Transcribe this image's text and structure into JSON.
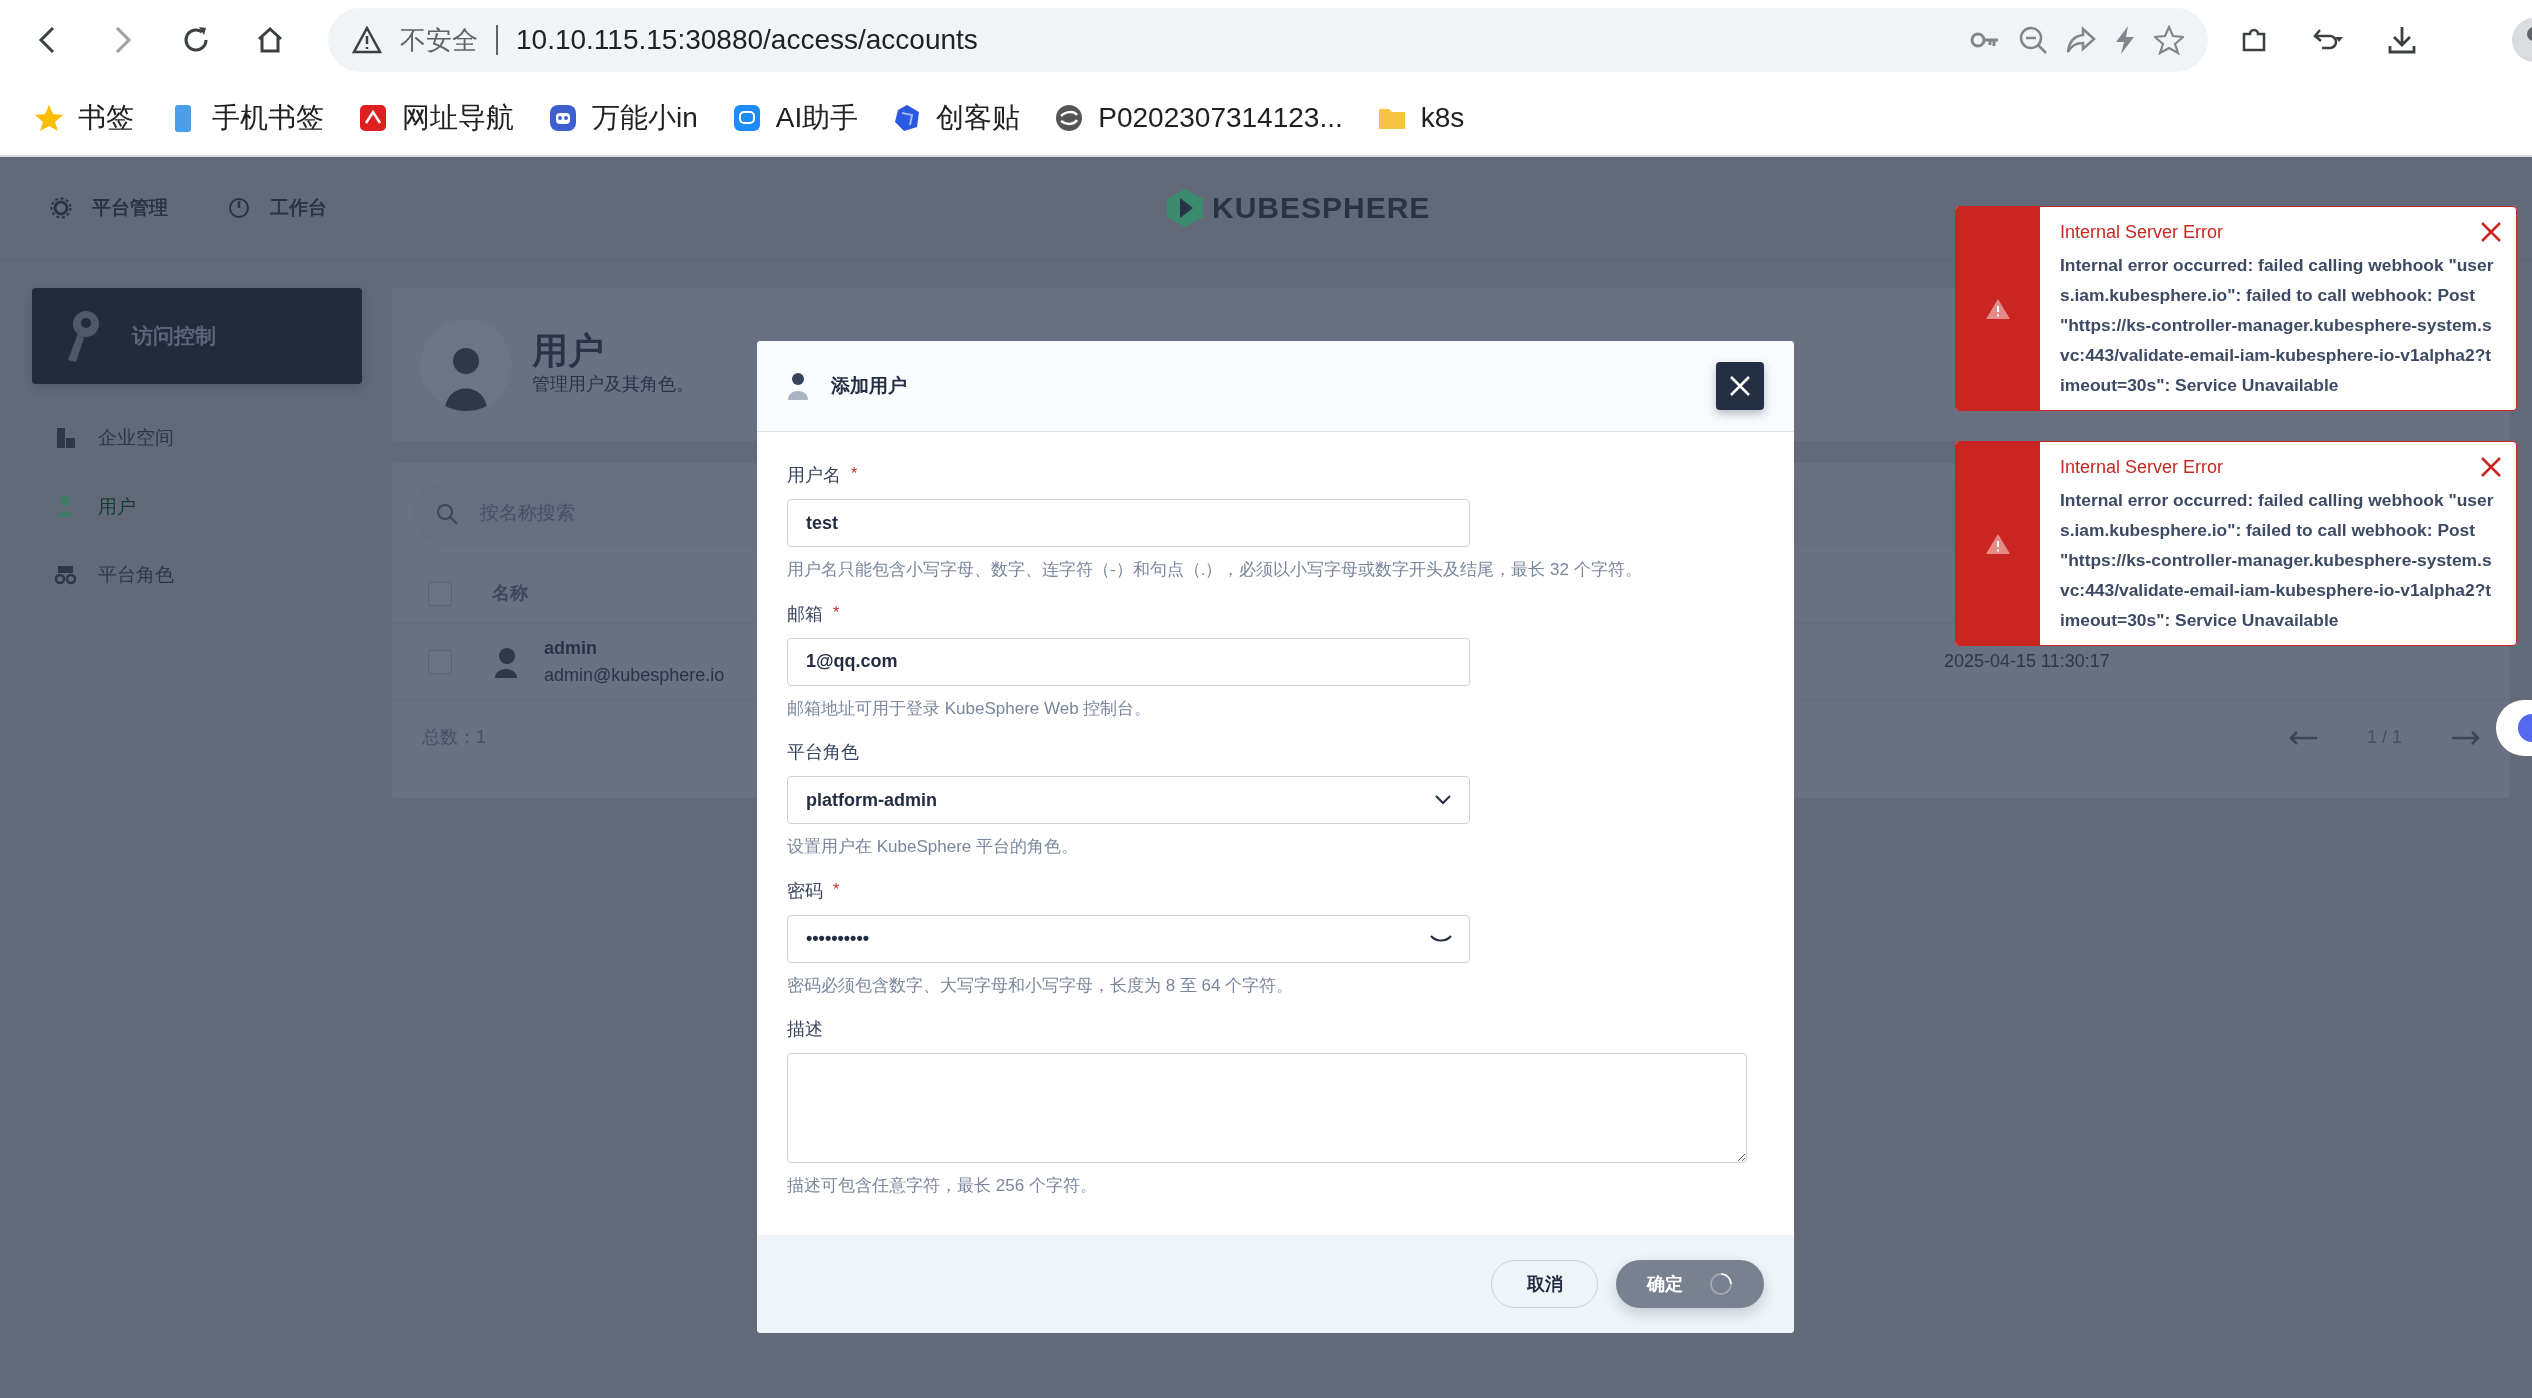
{
  "browser": {
    "security_label": "不安全",
    "url": "10.10.115.15:30880/access/accounts",
    "bookmarks": [
      {
        "kind": "star",
        "label": "书签"
      },
      {
        "kind": "phone",
        "label": "手机书签"
      },
      {
        "kind": "nav-app",
        "label": "网址导航"
      },
      {
        "kind": "robot",
        "label": "万能小in"
      },
      {
        "kind": "chat",
        "label": "AI助手"
      },
      {
        "kind": "cube",
        "label": "创客贴"
      },
      {
        "kind": "swirl",
        "label": "P0202307314123..."
      },
      {
        "kind": "folder",
        "label": "k8s"
      }
    ]
  },
  "header": {
    "nav": [
      {
        "kind": "gear",
        "label": "平台管理"
      },
      {
        "kind": "dial",
        "label": "工作台"
      }
    ],
    "logo": "KUBESPHERE"
  },
  "sidebar": {
    "title": "访问控制",
    "items": [
      {
        "kind": "workspace",
        "label": "企业空间",
        "selected": false
      },
      {
        "kind": "user",
        "label": "用户",
        "selected": true
      },
      {
        "kind": "role",
        "label": "平台角色",
        "selected": false
      }
    ]
  },
  "page_header": {
    "title": "用户",
    "subtitle": "管理用户及其角色。"
  },
  "table": {
    "search_placeholder": "按名称搜索",
    "columns": [
      "名称"
    ],
    "select_all_checked": false,
    "rows": [
      {
        "checked": false,
        "name": "admin",
        "email": "admin@kubesphere.io",
        "column_2": "2025-04-15 11:30:17"
      }
    ],
    "total": "总数：1",
    "pagination": "1 / 1"
  },
  "dialog": {
    "title": "添加用户",
    "fields": [
      {
        "kind": "text",
        "label": "用户名",
        "required_mark": "*",
        "value": "test",
        "hint": "用户名只能包含小写字母、数字、连字符（-）和句点（.），必须以小写字母或数字开头及结尾，最长 32 个字符。"
      },
      {
        "kind": "text",
        "label": "邮箱",
        "required_mark": "*",
        "value": "1@qq.com",
        "hint": "邮箱地址可用于登录 KubeSphere Web 控制台。"
      },
      {
        "kind": "select",
        "label": "平台角色",
        "value": "platform-admin",
        "hint": "设置用户在 KubeSphere 平台的角色。"
      },
      {
        "kind": "password",
        "label": "密码",
        "required_mark": "*",
        "value": "••••••••••",
        "hint": "密码必须包含数字、大写字母和小写字母，长度为 8 至 64 个字符。"
      },
      {
        "kind": "textarea",
        "label": "描述",
        "hint": "描述可包含任意字符，最长 256 个字符。"
      }
    ],
    "cancel": "取消",
    "confirm": "确定",
    "loading": true
  },
  "toasts": [
    {
      "title": "Internal Server Error",
      "message": "Internal error occurred: failed calling webhook \"users.iam.kubesphere.io\": failed to call webhook: Post \"https://ks-controller-manager.kubesphere-system.svc:443/validate-email-iam-kubesphere-io-v1alpha2?timeout=30s\": Service Unavailable"
    },
    {
      "title": "Internal Server Error",
      "message": "Internal error occurred: failed calling webhook \"users.iam.kubesphere.io\": failed to call webhook: Post \"https://ks-controller-manager.kubesphere-system.svc:443/validate-email-iam-kubesphere-io-v1alpha2?timeout=30s\": Service Unavailable"
    }
  ]
}
